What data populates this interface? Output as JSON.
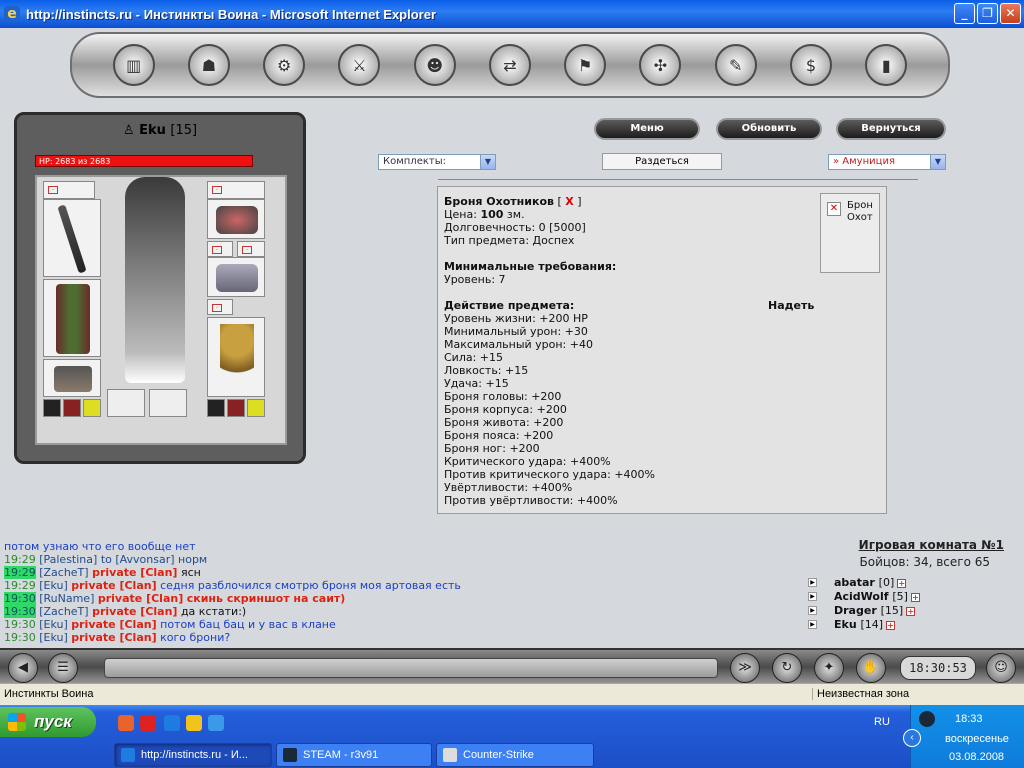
{
  "window": {
    "title": "http://instincts.ru - Инстинкты Воина - Microsoft Internet Explorer",
    "minimize": "_",
    "maximize": "❐",
    "close": "✕"
  },
  "nav": {
    "icons": [
      "chart-icon",
      "bag-icon",
      "gear-icon",
      "sword-icon",
      "face-icon",
      "transfer-icon",
      "flag-icon",
      "map-icon",
      "scroll-icon",
      "dollar-icon",
      "door-icon"
    ],
    "glyphs": [
      "▥",
      "☗",
      "⚙",
      "⚔",
      "☻",
      "⇄",
      "⚑",
      "✣",
      "✎",
      "$",
      "▮"
    ]
  },
  "character": {
    "name": "Eku",
    "level": "[15]",
    "hp": "HP: 2683 из 2683",
    "hp_fraction": 1.0
  },
  "actions": {
    "menu": "Меню",
    "refresh": "Обновить",
    "back": "Вернуться"
  },
  "filters": {
    "sets": "Комплекты:",
    "undress": "Раздеться",
    "category": "» Амуниция"
  },
  "item": {
    "name": "Броня Охотников",
    "remove_mark": "X",
    "price_label": "Цена:",
    "price_value": "100",
    "price_unit": "зм.",
    "durability": "Долговечность: 0 [5000]",
    "type": "Тип предмета: Доспех",
    "req_title": "Минимальные требования:",
    "req_level": "Уровень: 7",
    "effect_title": "Действие предмета:",
    "equip": "Надеть",
    "effects": [
      "Уровень жизни: +200 HP",
      "Минимальный урон: +30",
      "Максимальный урон: +40",
      "Сила: +15",
      "Ловкость: +15",
      "Удача: +15",
      "Броня головы: +200",
      "Броня корпуса: +200",
      "Броня живота: +200",
      "Броня пояса: +200",
      "Броня ног: +200",
      "Критического удара: +400%",
      "Против критического удара: +400%",
      "Увёртливости: +400%",
      "Против увёртливости: +400%"
    ],
    "preview_line1": "Брон",
    "preview_line2": "Охот"
  },
  "chat": [
    {
      "time": "",
      "hl": false,
      "nick": "",
      "priv": "",
      "text": "потом узнаю что его вообще нет",
      "text_color": "blue"
    },
    {
      "time": "19:29",
      "hl": false,
      "nick": "[Palestina]",
      "priv": "",
      "text": "to [Avvonsar] норм",
      "text_color": "mixed"
    },
    {
      "time": "19:29",
      "hl": true,
      "nick": "[ZacheT]",
      "priv": "private [Clan]",
      "text": "ясн",
      "text_color": "black"
    },
    {
      "time": "19:29",
      "hl": false,
      "nick": "[Eku]",
      "priv": "private [Clan]",
      "text": "седня разблочился смотрю броня моя артовая есть",
      "text_color": "blue"
    },
    {
      "time": "19:30",
      "hl": true,
      "nick": "[RuName]",
      "priv": "private [Clan]",
      "text": "скинь скриншот на саит)",
      "text_color": "red"
    },
    {
      "time": "19:30",
      "hl": true,
      "nick": "[ZacheT]",
      "priv": "private [Clan]",
      "text": "да кстати:)",
      "text_color": "black"
    },
    {
      "time": "19:30",
      "hl": false,
      "nick": "[Eku]",
      "priv": "private [Clan]",
      "text": "потом бац бац и у вас в клане",
      "text_color": "blue"
    },
    {
      "time": "19:30",
      "hl": false,
      "nick": "[Eku]",
      "priv": "private [Clan]",
      "text": "кого брони?",
      "text_color": "blue"
    }
  ],
  "room": {
    "title": "Игровая комната №1",
    "count": "Бойцов: 34, всего 65",
    "players": [
      {
        "name": "abatar",
        "level": "[0]"
      },
      {
        "name": "AcidWolf",
        "level": "[5]"
      },
      {
        "name": "Drager",
        "level": "[15]"
      },
      {
        "name": "Eku",
        "level": "[14]"
      }
    ]
  },
  "clock": "18:30:53",
  "status": {
    "left": "Инстинкты Воина",
    "right": "Неизвестная зона"
  },
  "taskbar": {
    "start": "пуск",
    "lang": "RU",
    "time": "18:33",
    "day": "воскресенье",
    "date": "03.08.2008",
    "items": [
      {
        "label": "http://instincts.ru - И...",
        "active": true
      },
      {
        "label": "STEAM - r3v91",
        "active": false
      },
      {
        "label": "Counter-Strike",
        "active": false
      }
    ]
  }
}
